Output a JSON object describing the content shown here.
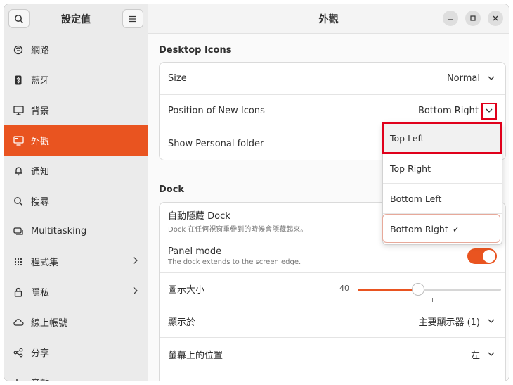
{
  "sidebar": {
    "title": "設定值",
    "items": [
      {
        "label": "網路",
        "icon": "network-icon"
      },
      {
        "label": "藍牙",
        "icon": "bluetooth-icon"
      },
      {
        "label": "背景",
        "icon": "background-icon"
      },
      {
        "label": "外觀",
        "icon": "appearance-icon",
        "active": true
      },
      {
        "label": "通知",
        "icon": "bell-icon"
      },
      {
        "label": "搜尋",
        "icon": "search-icon"
      },
      {
        "label": "Multitasking",
        "icon": "multitasking-icon"
      },
      {
        "label": "程式集",
        "icon": "apps-grid-icon",
        "chevron": true
      },
      {
        "label": "隱私",
        "icon": "lock-icon",
        "chevron": true
      },
      {
        "label": "線上帳號",
        "icon": "cloud-icon"
      },
      {
        "label": "分享",
        "icon": "share-icon"
      },
      {
        "label": "音效",
        "icon": "music-icon"
      }
    ]
  },
  "main": {
    "title": "外觀",
    "desktop_icons": {
      "section_title": "Desktop Icons",
      "size_label": "Size",
      "size_value": "Normal",
      "position_label": "Position of New Icons",
      "position_value": "Bottom Right",
      "personal_folder_label": "Show Personal folder"
    },
    "dock": {
      "section_title": "Dock",
      "autohide_label": "自動隱藏 Dock",
      "autohide_sub": "Dock 在任何視窗重疊到的時候會隱藏起來。",
      "panel_label": "Panel mode",
      "panel_sub": "The dock extends to the screen edge.",
      "panel_on": true,
      "icon_size_label": "圖示大小",
      "icon_size_value": "40",
      "icon_size_fraction": 0.42,
      "show_on_label": "顯示於",
      "show_on_value": "主要顯示器 (1)",
      "position_label": "螢幕上的位置",
      "position_value": "左"
    },
    "popover": {
      "options": [
        "Top Left",
        "Top Right",
        "Bottom Left",
        "Bottom Right"
      ],
      "selected_mark": "✓"
    }
  },
  "colors": {
    "accent": "#e95420",
    "highlight": "#e0001b"
  }
}
